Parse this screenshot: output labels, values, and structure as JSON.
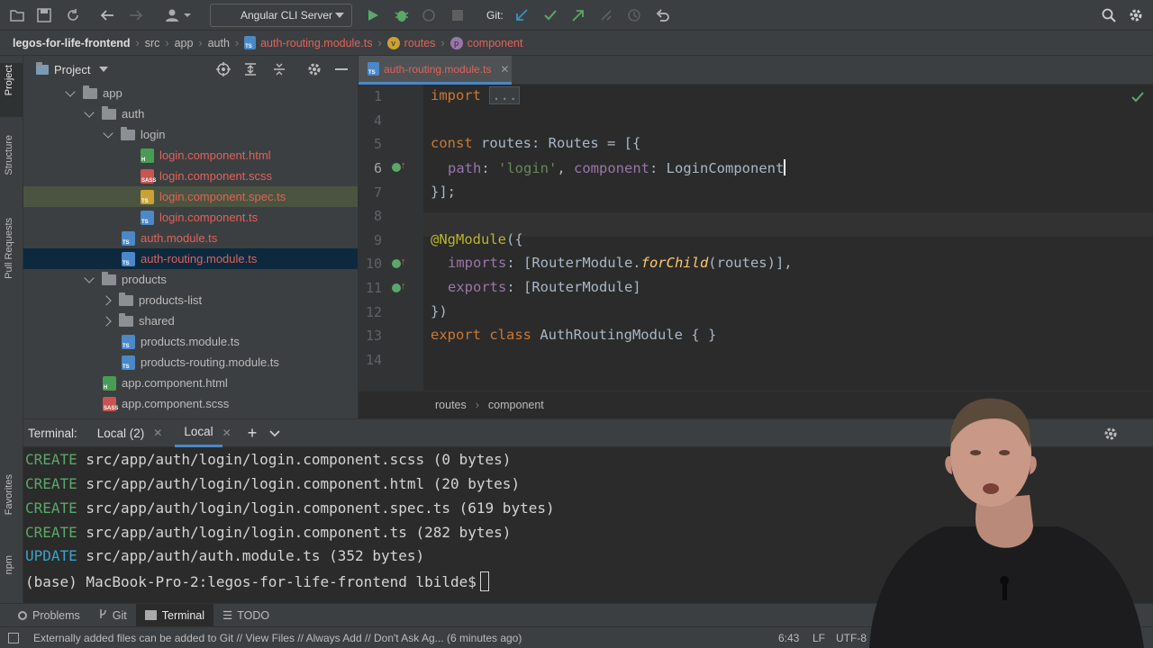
{
  "toolbar": {
    "run_config": "Angular CLI Server",
    "git_label": "Git:"
  },
  "breadcrumb": [
    "legos-for-life-frontend",
    "src",
    "app",
    "auth",
    "auth-routing.module.ts",
    "routes",
    "component"
  ],
  "left_stripe": {
    "project": "Project",
    "structure": "Structure",
    "pull_requests": "Pull Requests",
    "favorites": "Favorites",
    "npm": "npm"
  },
  "project_panel": {
    "title": "Project",
    "tree": [
      {
        "label": "app",
        "type": "folder",
        "expanded": true
      },
      {
        "label": "auth",
        "type": "folder",
        "expanded": true
      },
      {
        "label": "login",
        "type": "folder",
        "expanded": true
      },
      {
        "label": "login.component.html",
        "type": "html"
      },
      {
        "label": "login.component.scss",
        "type": "scss"
      },
      {
        "label": "login.component.spec.ts",
        "type": "spec"
      },
      {
        "label": "login.component.ts",
        "type": "ts"
      },
      {
        "label": "auth.module.ts",
        "type": "ts"
      },
      {
        "label": "auth-routing.module.ts",
        "type": "ts"
      },
      {
        "label": "products",
        "type": "folder",
        "expanded": true
      },
      {
        "label": "products-list",
        "type": "folder",
        "expanded": false
      },
      {
        "label": "shared",
        "type": "folder",
        "expanded": false
      },
      {
        "label": "products.module.ts",
        "type": "ts"
      },
      {
        "label": "products-routing.module.ts",
        "type": "ts"
      },
      {
        "label": "app.component.html",
        "type": "html"
      },
      {
        "label": "app.component.scss",
        "type": "scss"
      }
    ]
  },
  "editor": {
    "active_tab": "auth-routing.module.ts",
    "line_numbers": [
      "1",
      "4",
      "5",
      "6",
      "7",
      "8",
      "9",
      "10",
      "11",
      "12",
      "13",
      "14"
    ],
    "code": {
      "l1_kw": "import",
      "l1_fold": "...",
      "l5_kw": "const",
      "l5_rest": " routes: Routes = [{",
      "l6_p1": "path",
      "l6_c1": ": ",
      "l6_s": "'login'",
      "l6_c2": ", ",
      "l6_p2": "component",
      "l6_c3": ": LoginComponent",
      "l7": "}];",
      "l9_ann": "@NgModule",
      "l9_rest": "({",
      "l10_p": "imports",
      "l10_a": ": [RouterModule.",
      "l10_fn": "forChild",
      "l10_b": "(routes)],",
      "l11_p": "exports",
      "l11_a": ": [RouterModule]",
      "l12": "})",
      "l13_kw": "export class",
      "l13_rest": " AuthRoutingModule { }"
    },
    "bottom_crumbs": [
      "routes",
      "component"
    ]
  },
  "terminal": {
    "label": "Terminal:",
    "tabs": [
      "Local (2)",
      "Local"
    ],
    "lines": [
      {
        "action": "CREATE",
        "text": " src/app/auth/login/login.component.scss (0 bytes)"
      },
      {
        "action": "CREATE",
        "text": " src/app/auth/login/login.component.html (20 bytes)"
      },
      {
        "action": "CREATE",
        "text": " src/app/auth/login/login.component.spec.ts (619 bytes)"
      },
      {
        "action": "CREATE",
        "text": " src/app/auth/login/login.component.ts (282 bytes)"
      },
      {
        "action": "UPDATE",
        "text": " src/app/auth/auth.module.ts (352 bytes)"
      }
    ],
    "prompt": "(base) MacBook-Pro-2:legos-for-life-frontend lbilde$"
  },
  "tool_windows": [
    "Problems",
    "Git",
    "Terminal",
    "TODO"
  ],
  "status": {
    "message": "Externally added files can be added to Git // View Files // Always Add // Don't Ask Ag... (6 minutes ago)",
    "position": "6:43",
    "line_sep": "LF",
    "encoding": "UTF-8"
  },
  "colors": {
    "accent": "#4a88c7",
    "keyword": "#cc7832",
    "string": "#6a8759",
    "error": "#e0625a",
    "success": "#59a869"
  }
}
